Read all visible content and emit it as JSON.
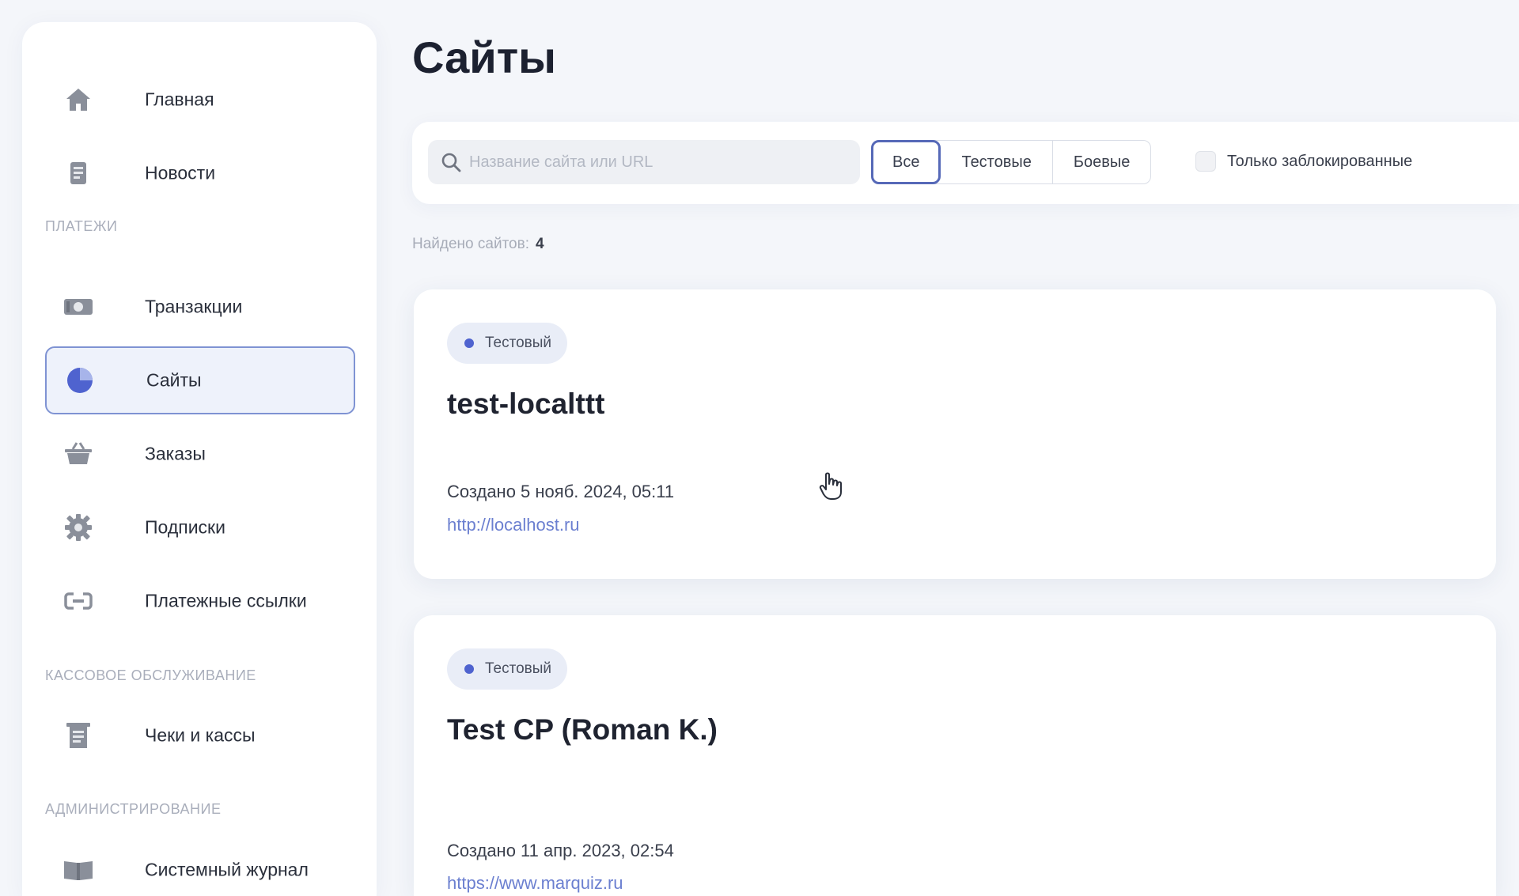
{
  "sidebar": {
    "items": [
      {
        "label": "Главная",
        "icon": "home-icon"
      },
      {
        "label": "Новости",
        "icon": "news-icon"
      },
      {
        "label": "Транзакции",
        "icon": "transactions-icon"
      },
      {
        "label": "Сайты",
        "icon": "sites-icon",
        "active": true
      },
      {
        "label": "Заказы",
        "icon": "basket-icon"
      },
      {
        "label": "Подписки",
        "icon": "gear-icon"
      },
      {
        "label": "Платежные ссылки",
        "icon": "link-icon"
      },
      {
        "label": "Чеки и кассы",
        "icon": "receipt-icon"
      },
      {
        "label": "Системный журнал",
        "icon": "book-icon"
      }
    ],
    "sections": {
      "payments": "ПЛАТЕЖИ",
      "cashier": "КАССОВОЕ ОБСЛУЖИВАНИЕ",
      "admin": "АДМИНИСТРИРОВАНИЕ"
    }
  },
  "main": {
    "title": "Сайты",
    "search": {
      "placeholder": "Название сайта или URL",
      "value": ""
    },
    "filters": {
      "all": "Все",
      "test": "Тестовые",
      "live": "Боевые"
    },
    "blocked_only": "Только заблокированные",
    "found_label": "Найдено сайтов:",
    "found_count": "4"
  },
  "sites": [
    {
      "badge": "Тестовый",
      "name": "test-localttt",
      "created": "Создано 5 нояб. 2024, 05:11",
      "url": "http://localhost.ru"
    },
    {
      "badge": "Тестовый",
      "name": "Test CP (Roman K.)",
      "created": "Создано 11 апр. 2023, 02:54",
      "url": "https://www.marquiz.ru"
    }
  ],
  "colors": {
    "accent": "#5669b8",
    "link": "#6b7fd0",
    "badge_dot": "#4f63cf",
    "background": "#f4f6fa"
  }
}
